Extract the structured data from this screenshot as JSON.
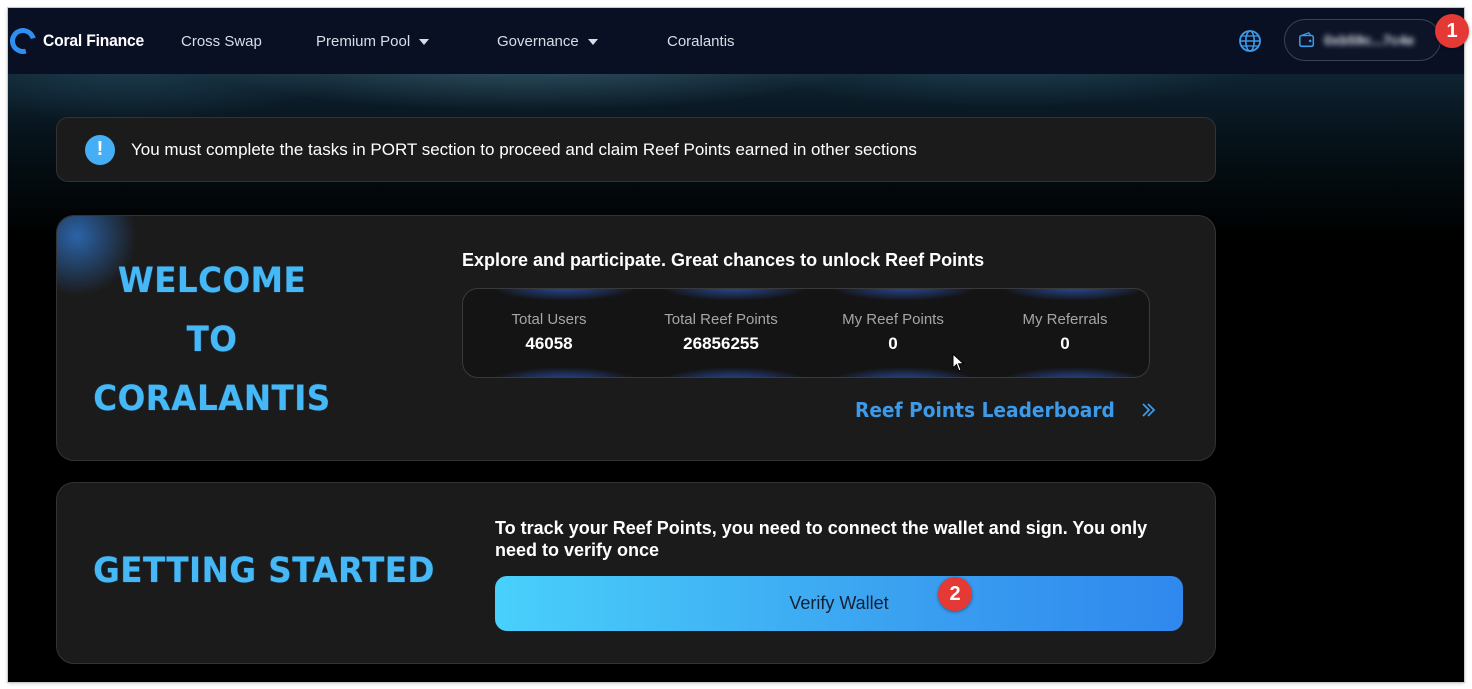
{
  "nav": {
    "brand": "Coral Finance",
    "items": [
      {
        "label": "Cross Swap",
        "dropdown": false
      },
      {
        "label": "Premium Pool",
        "dropdown": true
      },
      {
        "label": "Governance",
        "dropdown": true
      },
      {
        "label": "Coralantis",
        "dropdown": false
      }
    ],
    "globe_icon": "globe-icon",
    "wallet_icon": "wallet-icon",
    "wallet_address": "0xb59c...7c4e"
  },
  "notice": {
    "icon": "info-icon",
    "icon_glyph": "!",
    "text": "You must complete the tasks in PORT section to proceed and claim Reef Points earned in other sections"
  },
  "welcome": {
    "title_lines": [
      "WELCOME",
      "TO",
      "CORALANTIS"
    ],
    "subtitle": "Explore and participate. Great chances to unlock Reef Points",
    "stats": [
      {
        "label": "Total Users",
        "value": "46058"
      },
      {
        "label": "Total Reef Points",
        "value": "26856255"
      },
      {
        "label": "My Reef Points",
        "value": "0"
      },
      {
        "label": "My Referrals",
        "value": "0"
      }
    ],
    "leaderboard_label": "Reef Points Leaderboard"
  },
  "getting_started": {
    "title": "GETTING STARTED",
    "text": "To track your Reef Points, you need to connect the wallet and sign. You only need to verify once",
    "button_label": "Verify Wallet"
  },
  "markers": [
    "1",
    "2"
  ],
  "colors": {
    "accent": "#45b8f5",
    "navbar_bg": "#0a1024",
    "card_bg": "#1b1b1b",
    "marker_red": "#e53935"
  }
}
